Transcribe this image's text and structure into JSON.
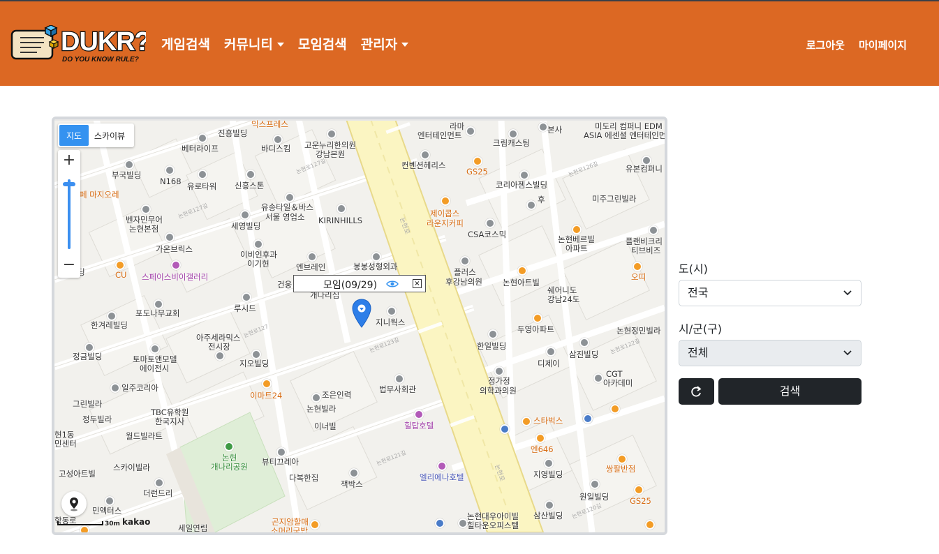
{
  "brand": {
    "logo_text": "DUKR?",
    "logo_tagline": "DO YOU KNOW RULE?"
  },
  "nav": {
    "left": [
      {
        "label": "게임검색",
        "dropdown": false
      },
      {
        "label": "커뮤니티",
        "dropdown": true
      },
      {
        "label": "모임검색",
        "dropdown": false
      },
      {
        "label": "관리자",
        "dropdown": true
      }
    ],
    "right": [
      {
        "label": "로그아웃"
      },
      {
        "label": "마이페이지"
      }
    ]
  },
  "map": {
    "type_control": {
      "map": "지도",
      "skyview": "스카이뷰"
    },
    "zoom_in": "+",
    "zoom_out": "−",
    "scale_label": "30m",
    "attribution": "kakao",
    "infowindow": {
      "title": "모임(09/29)",
      "close": "×"
    },
    "labels": [
      "진흥빌딩",
      "익스프레스",
      "바디스킴",
      "베터라이프",
      "고운누리한의원",
      "강남본원",
      "라마",
      "엔터테인먼트",
      "크림캐스팅",
      "본사",
      "미도리 컴퍼니 EDM",
      "ASIA 에센셜 엔터테인먼",
      "부국빌딩",
      "N168",
      "유로타워",
      "신흥스톤",
      "페 마지오레",
      "컨벤션헤리스",
      "GS25",
      "코리아젬스빌딩",
      "유본컴퍼니",
      "후",
      "미주그린빌라",
      "유송타일＆바스",
      "서울 영업소",
      "벤자민무어",
      "논현본점",
      "세영빌딩",
      "KIRINHILLS",
      "제이콥스",
      "라운지커피",
      "CSA코스믹",
      "논현베르빌",
      "아파트",
      "플랜비크리",
      "티브비즈",
      "가온브릭스",
      "이비인후과",
      "이기현",
      "엔브레인",
      "봉봉성형외과",
      "CU",
      "스페이스비이갤러리",
      "플러스",
      "후강남의원",
      "논현아트빌",
      "오띠",
      "쉐어니도",
      "강남24도",
      "건웅",
      "개나리집",
      "지니웍스",
      "포도나무교회",
      "루시드",
      "한겨레빌딩",
      "두영아파트",
      "논현정민빌라",
      "아주세라믹스",
      "전시장",
      "한일빌딩",
      "삼진빌딩",
      "정금빌딩",
      "토마토앤모델",
      "에이전시",
      "지오빌딩",
      "디제이",
      "CGT",
      "아카데미",
      "일주코리아",
      "이마트24",
      "조은인력",
      "법무사회관",
      "정가정",
      "의학과의원",
      "그린빌라",
      "TBC유학원",
      "한국지사",
      "논현빌라",
      "정두빌라",
      "이너빌",
      "힐탑호텔",
      "스타벅스",
      "월드빌라트",
      "엔646",
      "현1동",
      "민센터",
      "논현",
      "개나리공원",
      "쌍팔반점",
      "뷰티끄레아",
      "스카이빌라",
      "고성아트빌",
      "지영빌딩",
      "다복한집",
      "엘리에나호텔",
      "잭박스",
      "더런드리",
      "원일빌딩",
      "민엑터스",
      "GS25",
      "곤지암할매",
      "소머리국밥",
      "세일연립",
      "논현대우아이빌",
      "힐타운오피스텔",
      "삼산빌딩",
      "학동로",
      "논현로",
      "릴빌딩"
    ]
  },
  "form": {
    "province_label": "도(시)",
    "province_value": "전국",
    "city_label": "시/군(구)",
    "city_value": "전체",
    "reset_icon": "refresh-icon",
    "search_label": "검색"
  },
  "colors": {
    "navbar": "#dc6823",
    "button_dark": "#212529",
    "map_active": "#3492f0",
    "marker": "#2d7ee8"
  }
}
